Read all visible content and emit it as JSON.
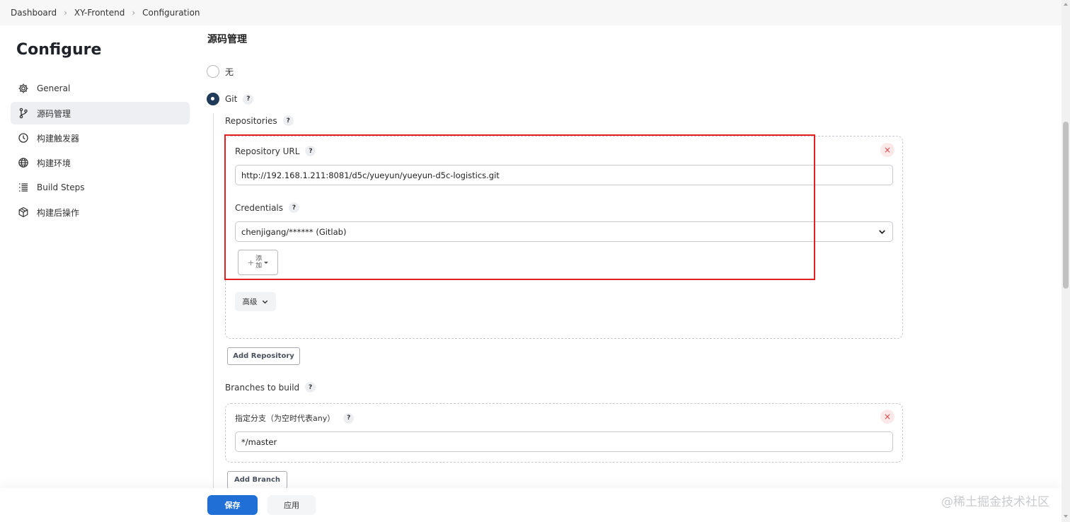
{
  "breadcrumb": [
    {
      "label": "Dashboard"
    },
    {
      "label": "XY-Frontend"
    },
    {
      "label": "Configuration"
    }
  ],
  "sidebar": {
    "title": "Configure",
    "items": [
      {
        "label": "General",
        "icon": "gear-icon",
        "active": false
      },
      {
        "label": "源码管理",
        "icon": "branch-icon",
        "active": true
      },
      {
        "label": "构建触发器",
        "icon": "clock-icon",
        "active": false
      },
      {
        "label": "构建环境",
        "icon": "globe-icon",
        "active": false
      },
      {
        "label": "Build Steps",
        "icon": "list-icon",
        "active": false
      },
      {
        "label": "构建后操作",
        "icon": "box-icon",
        "active": false
      }
    ]
  },
  "scm": {
    "title": "源码管理",
    "option_none": "无",
    "option_git": "Git",
    "selected": "Git",
    "help": "?",
    "repositories_label": "Repositories",
    "repo_url_label": "Repository URL",
    "repo_url_value": "http://192.168.1.211:8081/d5c/yueyun/yueyun-d5c-logistics.git",
    "credentials_label": "Credentials",
    "credentials_value": "chenjigang/****** (Gitlab)",
    "add_plus": "+",
    "add_label_1": "添",
    "add_label_2": "加",
    "advanced_label": "高级",
    "add_repository": "Add Repository",
    "branches_label": "Branches to build",
    "branch_specifier_label": "指定分支（为空时代表any）",
    "branch_value": "*/master",
    "add_branch": "Add Branch",
    "remove_symbol": "×"
  },
  "footer": {
    "save": "保存",
    "apply": "应用"
  },
  "watermark": "@稀土掘金技术社区",
  "colors": {
    "primary": "#1f6fd6",
    "highlight_frame": "#e3201f",
    "radio_checked": "#1f3b57"
  }
}
